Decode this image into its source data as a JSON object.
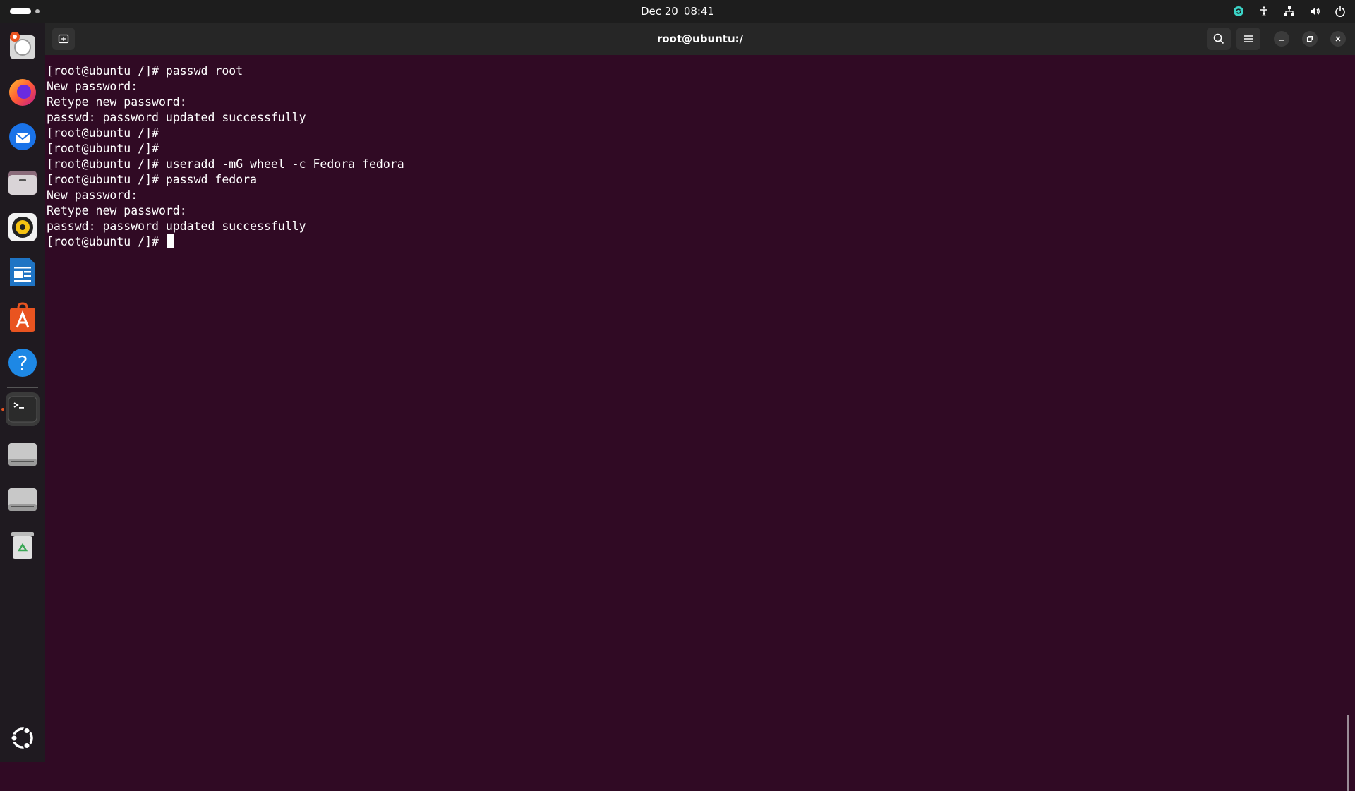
{
  "topbar": {
    "date": "Dec 20",
    "time": "08:41"
  },
  "window": {
    "title": "root@ubuntu:/"
  },
  "terminal": {
    "lines": [
      "[root@ubuntu /]# passwd root",
      "New password:",
      "Retype new password:",
      "passwd: password updated successfully",
      "[root@ubuntu /]#",
      "[root@ubuntu /]#",
      "[root@ubuntu /]# useradd -mG wheel -c Fedora fedora",
      "[root@ubuntu /]# passwd fedora",
      "New password:",
      "Retype new password:",
      "passwd: password updated successfully"
    ],
    "prompt": "[root@ubuntu /]# "
  },
  "dock": {
    "items": [
      "help-app-icon",
      "firefox-icon",
      "thunderbird-icon",
      "files-icon",
      "rhythmbox-icon",
      "writer-icon",
      "app-center-icon",
      "help-icon",
      "terminal-icon",
      "drive-icon",
      "drive-icon",
      "trash-icon",
      "show-apps-icon"
    ]
  },
  "colors": {
    "terminal_bg": "#300a24",
    "topbar_bg": "#1d1d1d",
    "headerbar_bg": "#262626",
    "accent": "#e95420"
  }
}
